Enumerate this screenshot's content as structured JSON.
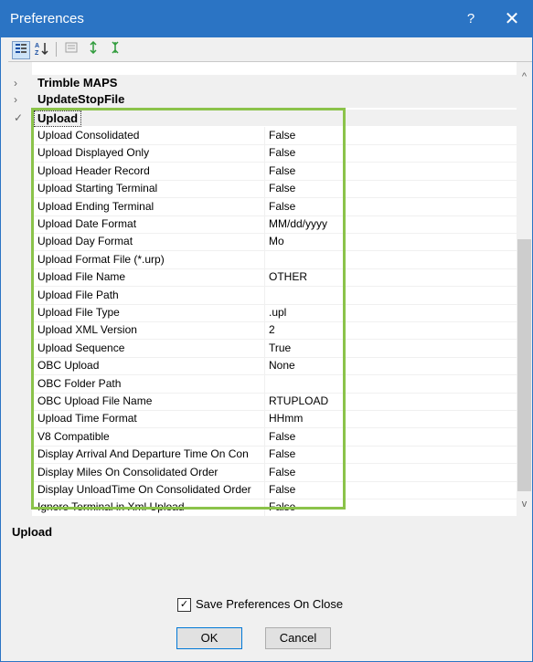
{
  "window": {
    "title": "Preferences",
    "help_label": "?",
    "close_label": "✕"
  },
  "toolbar": {
    "categorized_icon": "categorized-view-icon",
    "alphabetical_label": "A↓Z",
    "property_pages_icon": "property-pages-icon",
    "expand_icon": "expand-all-icon",
    "collapse_icon": "collapse-all-icon"
  },
  "grid": {
    "categories": [
      {
        "label": "Trimble MAPS",
        "expanded": false
      },
      {
        "label": "UpdateStopFile",
        "expanded": false
      },
      {
        "label": "Upload",
        "expanded": true
      }
    ],
    "rows": [
      {
        "name": "Upload Consolidated",
        "value": "False"
      },
      {
        "name": "Upload Displayed Only",
        "value": "False"
      },
      {
        "name": "Upload Header Record",
        "value": "False"
      },
      {
        "name": "Upload Starting Terminal",
        "value": "False"
      },
      {
        "name": "Upload Ending Terminal",
        "value": "False"
      },
      {
        "name": "Upload Date Format",
        "value": "MM/dd/yyyy"
      },
      {
        "name": "Upload Day Format",
        "value": "Mo"
      },
      {
        "name": "Upload Format File (*.urp)",
        "value": ""
      },
      {
        "name": "Upload File Name",
        "value": "OTHER"
      },
      {
        "name": "Upload File Path",
        "value": ""
      },
      {
        "name": "Upload File Type",
        "value": ".upl"
      },
      {
        "name": "Upload XML Version",
        "value": "2"
      },
      {
        "name": "Upload Sequence",
        "value": "True"
      },
      {
        "name": "OBC Upload",
        "value": "None"
      },
      {
        "name": "OBC Folder Path",
        "value": ""
      },
      {
        "name": "OBC Upload File Name",
        "value": "RTUPLOAD"
      },
      {
        "name": "Upload Time Format",
        "value": "HHmm"
      },
      {
        "name": "V8 Compatible",
        "value": "False"
      },
      {
        "name": "Display Arrival And Departure Time On Con",
        "value": "False"
      },
      {
        "name": "Display Miles On Consolidated Order",
        "value": "False"
      },
      {
        "name": "Display UnloadTime On Consolidated Order",
        "value": "False"
      },
      {
        "name": "Ignore Terminal in Xml Upload",
        "value": "False"
      }
    ],
    "highlight_color": "#8bc34a"
  },
  "description": {
    "title": "Upload"
  },
  "footer": {
    "save_on_close_label": "Save Preferences On Close",
    "save_on_close_checked": true,
    "ok_label": "OK",
    "cancel_label": "Cancel"
  }
}
